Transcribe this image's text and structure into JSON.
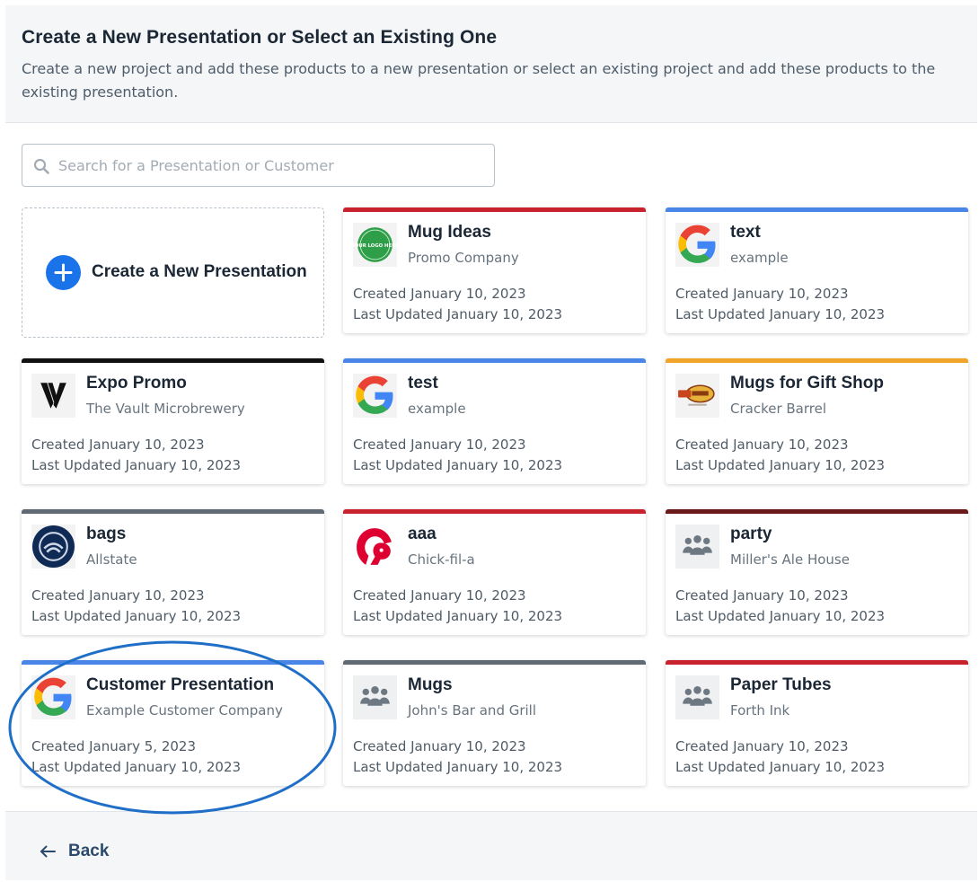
{
  "header": {
    "title": "Create a New Presentation or Select an Existing One",
    "subtitle": "Create a new project and add these products to a new presentation or select an existing project and add these products to the existing presentation."
  },
  "search": {
    "placeholder": "Search for a Presentation or Customer",
    "value": ""
  },
  "new_presentation": {
    "label": "Create a New Presentation"
  },
  "cards": [
    {
      "name": "Mug Ideas",
      "customer": "Promo Company",
      "created": "Created January 10, 2023",
      "updated": "Last Updated January 10, 2023",
      "accent": "#c8232c",
      "logo": "your-logo-here-logo",
      "logo_text": "YOUR LOGO HERE"
    },
    {
      "name": "text",
      "customer": "example",
      "created": "Created January 10, 2023",
      "updated": "Last Updated January 10, 2023",
      "accent": "#4a86e8",
      "logo": "google-logo"
    },
    {
      "name": "Expo Promo",
      "customer": "The Vault Microbrewery",
      "created": "Created January 10, 2023",
      "updated": "Last Updated January 10, 2023",
      "accent": "#111111",
      "logo": "vault-logo"
    },
    {
      "name": "test",
      "customer": "example",
      "created": "Created January 10, 2023",
      "updated": "Last Updated January 10, 2023",
      "accent": "#4a86e8",
      "logo": "google-logo"
    },
    {
      "name": "Mugs for Gift Shop",
      "customer": "Cracker Barrel",
      "created": "Created January 10, 2023",
      "updated": "Last Updated January 10, 2023",
      "accent": "#f0a429",
      "logo": "cracker-barrel-logo"
    },
    {
      "name": "bags",
      "customer": "Allstate",
      "created": "Created January 10, 2023",
      "updated": "Last Updated January 10, 2023",
      "accent": "#5f6a74",
      "logo": "allstate-logo"
    },
    {
      "name": "aaa",
      "customer": "Chick-fil-a",
      "created": "Created January 10, 2023",
      "updated": "Last Updated January 10, 2023",
      "accent": "#c8232c",
      "logo": "chick-fil-a-logo"
    },
    {
      "name": "party",
      "customer": "Miller's Ale House",
      "created": "Created January 10, 2023",
      "updated": "Last Updated January 10, 2023",
      "accent": "#6b1a1a",
      "logo": "people-group-icon"
    },
    {
      "name": "Customer Presentation",
      "customer": "Example Customer Company",
      "created": "Created January 5, 2023",
      "updated": "Last Updated January 10, 2023",
      "accent": "#4a86e8",
      "logo": "google-logo"
    },
    {
      "name": "Mugs",
      "customer": "John's Bar and Grill",
      "created": "Created January 10, 2023",
      "updated": "Last Updated January 10, 2023",
      "accent": "#5f6a74",
      "logo": "people-group-icon"
    },
    {
      "name": "Paper Tubes",
      "customer": "Forth Ink",
      "created": "Created January 10, 2023",
      "updated": "Last Updated January 10, 2023",
      "accent": "#c8232c",
      "logo": "people-group-icon"
    }
  ],
  "footer": {
    "back_label": "Back"
  },
  "colors": {
    "primary": "#1a73e8",
    "highlight_ring": "#1f6fc7"
  }
}
